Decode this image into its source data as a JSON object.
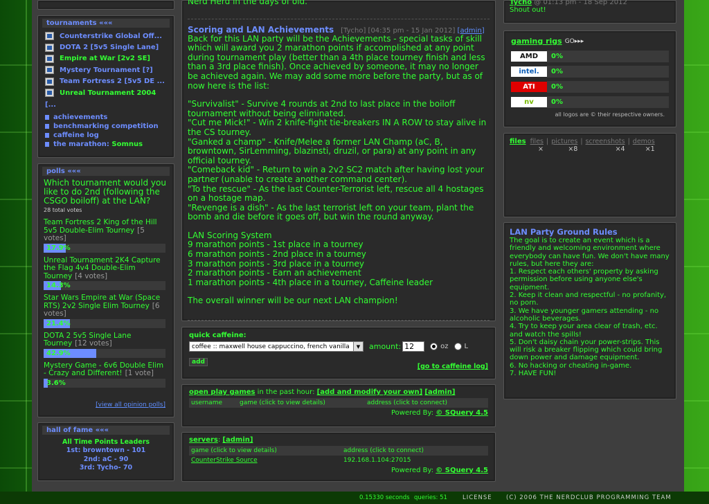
{
  "tournaments": {
    "header_label": "tournaments",
    "header_arrows": "«««",
    "items": [
      {
        "label": "Counterstrike Global Off...",
        "color": "#6d8dff"
      },
      {
        "label": "DOTA 2 [5v5 Single Lane]",
        "color": "#6d8dff"
      },
      {
        "label": "Empire at War [2v2 SE]",
        "color": "#33ff33"
      },
      {
        "label": "Mystery Tournament [?]",
        "color": "#6d8dff"
      },
      {
        "label": "Team Fortress 2 [5v5 DE ...",
        "color": "#6d8dff"
      },
      {
        "label": "Unreal Tournament 2004",
        "color": "#33ff33"
      }
    ],
    "more": "[...",
    "links": [
      {
        "label": "achievements",
        "extra": ""
      },
      {
        "label": "benchmarking competition",
        "extra": ""
      },
      {
        "label": "caffeine log",
        "extra": ""
      },
      {
        "label": "the marathon:",
        "extra": " Somnus"
      }
    ]
  },
  "polls": {
    "header_label": "polls",
    "header_arrows": "«««",
    "question": "Which tournament would you like to do 2nd (following the CSGO boiloff) at the LAN?",
    "total": "28 total votes",
    "options": [
      {
        "label": "Team Fortress 2 King of the Hill 5v5 Double-Elim Tourney",
        "votes": "[5 votes]",
        "pct": "17.9%",
        "value": 17.9
      },
      {
        "label": "Unreal Tournament 2K4 Capture the Flag 4v4 Double-Elim Tourney",
        "votes": "[4 votes]",
        "pct": "14.3%",
        "value": 14.3
      },
      {
        "label": "Star Wars Empire at War (Space RTS) 2v2 Single Elim Tourney",
        "votes": "[6 votes]",
        "pct": "21.4%",
        "value": 21.4
      },
      {
        "label": "DOTA 2 5v5 Single Lane Tourney",
        "votes": "[12 votes]",
        "pct": "42.9%",
        "value": 42.9
      },
      {
        "label": "Mystery Game - 6v6 Double Elim - Crazy and Different!",
        "votes": "[1 vote]",
        "pct": "3.6%",
        "value": 3.6
      }
    ],
    "view_all": "[view all opinion polls]"
  },
  "hall": {
    "header_label": "hall of fame",
    "header_arrows": "«««",
    "title": "All Time Points Leaders",
    "entries": [
      "1st: browntown - 101",
      "2nd: aC - 90",
      "3rd: Tycho- 70"
    ]
  },
  "article": {
    "top_text": "Nerd Herd in the days of old.",
    "title": "Scoring and LAN Achievements",
    "author": "[Tycho]",
    "date": "[04:35 pm - 15 Jan 2012]",
    "admin": "[admin]",
    "paragraphs": [
      "Back for this LAN party will be the Achievements - special tasks of skill which will award you 2 marathon points if accomplished at any point during tournament play (better than a 4th place tourney finish and less than a 3rd place finish). Once achieved by someone, it may no longer be achieved again. We may add some more before the party, but as of now here is the list:",
      "\"Survivalist\" - Survive 4 rounds at 2nd to last place in the boiloff tournament without being eliminated.\n\"Cut me Mick!\" - Win 2 knife-fight tie-breakers IN A ROW to stay alive in the CS tourney.\n\"Ganked a champ\" - Knife/Melee a former LAN Champ (aC, B, browntown, SirLemming, blazinsti, druzil, or para) at any point in any official tourney.\n\"Comeback kid\" - Return to win a 2v2 SC2 match after having lost your partner (unable to create another command center).\n\"To the rescue\" - As the last Counter-Terrorist left, rescue all 4 hostages on a hostage map.\n\"Revenge is a dish\" - As the last terrorist left on your team, plant the bomb and die before it goes off, but win the round anyway.",
      "LAN Scoring System\n9 marathon points - 1st place in a tourney\n6 marathon points - 2nd place in a tourney\n3 marathon points - 3rd place in a tourney\n2 marathon points - Earn an achievement\n1 marathon points - 4th place in a tourney, Caffeine leader",
      "The overall winner will be our next LAN champion!"
    ]
  },
  "caffeine": {
    "label": "quick caffeine:",
    "select_value": "coffee :: maxwell house cappuccino, french vanilla",
    "amount_label": "amount:",
    "amount_value": "12",
    "unit_oz": "oz",
    "unit_l": "L",
    "add_label": "add",
    "log_link": "[go to caffeine log]"
  },
  "open_games": {
    "link": "open play games",
    "text": " in the past hour: ",
    "add_link": "[add and modify your own]",
    "admin": "[admin]",
    "columns": [
      "username",
      "game (click to view details)",
      "address (click to connect)"
    ],
    "powered": "Powered By: ",
    "powered_link": "© SQuery 4.5"
  },
  "servers": {
    "link": "servers",
    "admin": "[admin]",
    "columns": [
      "game (click to view details)",
      "address (click to connect)"
    ],
    "rows": [
      {
        "game": "CounterStrike Source",
        "address": "192.168.1.104:27015"
      }
    ],
    "powered": "Powered By: ",
    "powered_link": "© SQuery 4.5"
  },
  "shoutbox": {
    "user": "Tycho",
    "time": "@ 01:13 pm - 18 Sep 2012",
    "message": "Shout out!"
  },
  "rigs": {
    "header": "gaming rigs",
    "items": [
      {
        "brand": "AMD",
        "pct": "0%",
        "bg": "#ffffff",
        "fg": "#111111"
      },
      {
        "brand": "intel.",
        "pct": "0%",
        "bg": "#ffffff",
        "fg": "#0a5bb5"
      },
      {
        "brand": "ATI",
        "pct": "0%",
        "bg": "#e00000",
        "fg": "#ffffff"
      },
      {
        "brand": "nv",
        "pct": "0%",
        "bg": "#ffffff",
        "fg": "#76b900"
      }
    ],
    "note": "all logos are © their respective owners."
  },
  "files": {
    "label": "files",
    "tabs": [
      {
        "label": "files",
        "count": "×"
      },
      {
        "label": "pictures",
        "count": "×8"
      },
      {
        "label": "screenshots",
        "count": "×4"
      },
      {
        "label": "demos",
        "count": "×1"
      }
    ]
  },
  "rules": {
    "title": "LAN Party Ground Rules",
    "text": "The goal is to create an event which is a friendly and welcoming environment where everybody can have fun. We don't have many rules, but here they are:\n1. Respect each others' property by asking permission before using anyone else's equipment.\n2. Keep it clean and respectful - no profanity, no porn.\n3. We have younger gamers attending - no alcoholic beverages.\n4. Try to keep your area clear of trash, etc. and watch the spills!\n5. Don't daisy chain your power-strips. This will risk a breaker flipping which could bring down power and damage equipment.\n6. No hacking or cheating in-game.\n7. HAVE FUN!"
  },
  "footer": {
    "time": "0.15330 seconds",
    "queries": "queries: 51",
    "license": "LICENSE",
    "copyright": "(C) 2006 THE NERDCLUB PROGRAMMING TEAM"
  }
}
